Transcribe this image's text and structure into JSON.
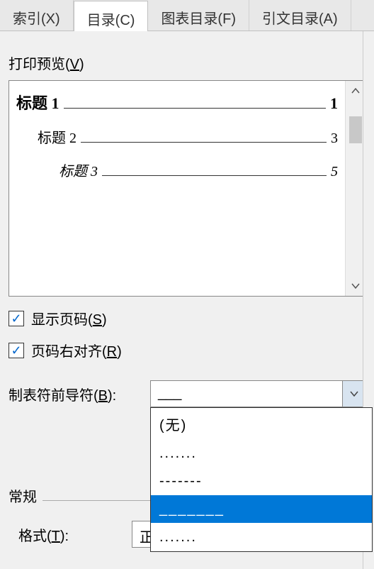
{
  "tabs": {
    "index": "索引(X)",
    "toc": "目录(C)",
    "figures": "图表目录(F)",
    "citations": "引文目录(A)"
  },
  "preview_label_prefix": "打印预览(",
  "preview_label_key": "V",
  "preview_label_suffix": ")",
  "toc_preview": {
    "line1": {
      "title": "标题 1",
      "page": "1"
    },
    "line2": {
      "title": "标题 2",
      "page": "3"
    },
    "line3": {
      "title": "标题 3",
      "page": "5"
    }
  },
  "checkboxes": {
    "show_page_prefix": "显示页码(",
    "show_page_key": "S",
    "show_page_suffix": ")",
    "right_align_prefix": "页码右对齐(",
    "right_align_key": "R",
    "right_align_suffix": ")"
  },
  "leader_label_prefix": "制表符前导符(",
  "leader_label_key": "B",
  "leader_label_suffix": "):",
  "leader_value": "___",
  "leader_options": {
    "opt0": "(无)",
    "opt1": ".......",
    "opt2": "-------",
    "opt3": "_______",
    "opt4": "......."
  },
  "general_header": "常规",
  "format_label_prefix": "格式(",
  "format_label_key": "T",
  "format_label_suffix": "):",
  "format_value": "正"
}
